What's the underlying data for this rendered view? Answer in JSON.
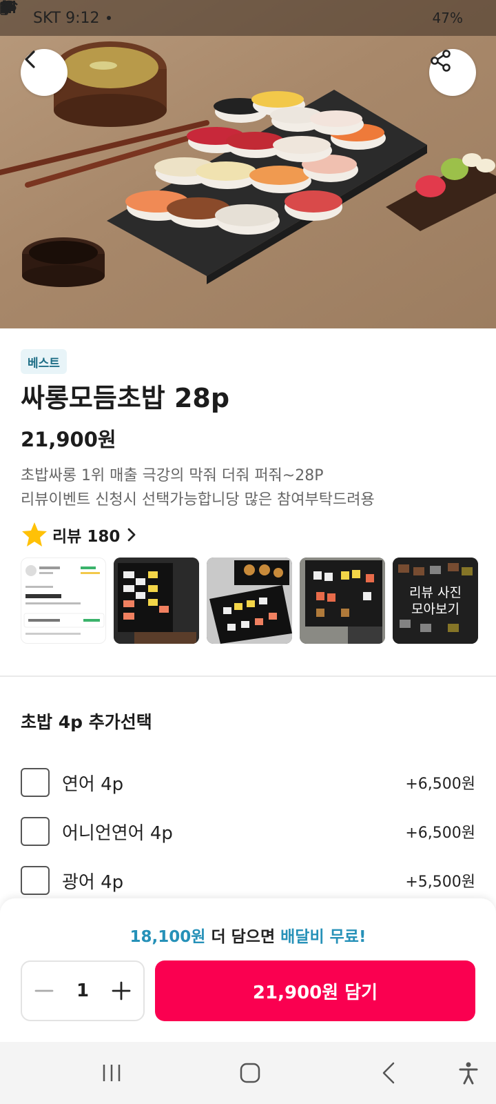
{
  "status_bar": {
    "carrier_time": "SKT 9:12",
    "battery": "47%",
    "icons": [
      "lightning-icon",
      "v-icon",
      "cloud-icon",
      "alarm-icon",
      "bluetooth-icon",
      "wifi-icon",
      "signal-icon",
      "battery-icon"
    ]
  },
  "header": {
    "back_icon": "chevron-left-icon",
    "share_icon": "share-icon"
  },
  "product": {
    "badge": "베스트",
    "title": "싸롱모듬초밥 28p",
    "price": "21,900원",
    "description_line1": "초밥싸롱 1위 매출 극강의 막줘 더줘 퍼줘~28P",
    "description_line2": "리뷰이벤트 신청시 선택가능합니당 많은 참여부탁드려용"
  },
  "reviews": {
    "label": "리뷰 180",
    "more_photos_label": "리뷰 사진\n모아보기"
  },
  "options": {
    "section_title": "초밥 4p 추가선택",
    "items": [
      {
        "name": "연어 4p",
        "price": "+6,500원",
        "checked": false
      },
      {
        "name": "어니언연어 4p",
        "price": "+6,500원",
        "checked": false
      },
      {
        "name": "광어 4p",
        "price": "+5,500원",
        "checked": false
      }
    ]
  },
  "cart_bar": {
    "promo_amount": "18,100원",
    "promo_middle": " 더 담으면 ",
    "promo_highlight": "배달비 무료!",
    "quantity": "1",
    "add_button": "21,900원 담기"
  },
  "colors": {
    "accent_pink": "#fa0050",
    "accent_blue": "#2691b8",
    "badge_bg": "#e8f4f8"
  }
}
